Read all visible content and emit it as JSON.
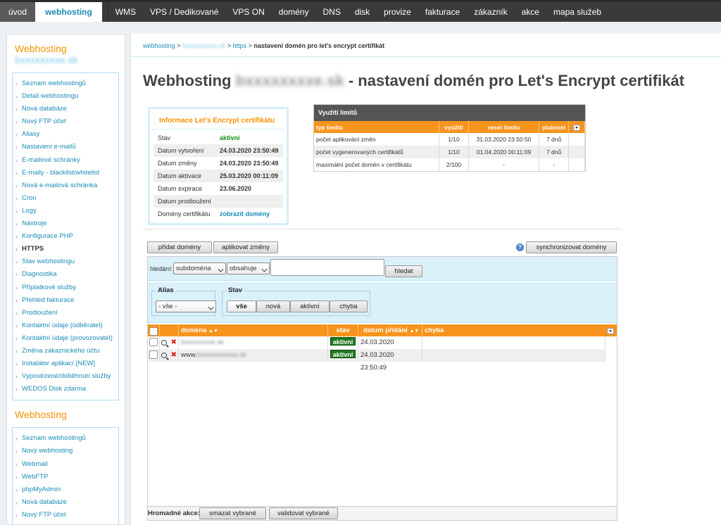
{
  "topnav": {
    "items": [
      "úvod",
      "webhosting",
      "WMS",
      "VPS / Dedikované",
      "VPS ON",
      "domény",
      "DNS",
      "disk",
      "provize",
      "fakturace",
      "zákazník",
      "akce",
      "mapa služeb"
    ]
  },
  "sidebar": {
    "block1_title": "Webhosting",
    "block1_domain": "bxxxxxxxxe.sk",
    "block1_items": [
      "Seznam webhostingů",
      "Detail webhostingu",
      "Nová databáze",
      "Nový FTP účet",
      "Aliasy",
      "Nastavení e-mailů",
      "E-mailové schránky",
      "E-maily - blacklist/whitelist",
      "Nová e-mailová schránka",
      "Cron",
      "Logy",
      "Nástroje",
      "Konfigurace PHP",
      "HTTPS",
      "Stav webhostingu",
      "Diagnostika",
      "Příplatkové služby",
      "Přehled fakturace",
      "Prodloužení",
      "Kontaktní údaje (odběratel)",
      "Kontaktní údaje (provozovatel)",
      "Změna zákaznického účtu",
      "Instalátor aplikací [NEW]",
      "Vypovězené/doběhnutí služby",
      "WEDOS Disk zdarma"
    ],
    "block2_title": "Webhosting",
    "block2_items": [
      "Seznam webhostingů",
      "Nový webhosting",
      "Webmail",
      "WebFTP",
      "phpMyAdmin",
      "Nová databáze",
      "Nový FTP účet"
    ]
  },
  "breadcrumb": {
    "webhosting": "webhosting",
    "sep": ">",
    "domain": "bxxxxxxxxxx.sk",
    "https": "https",
    "current": "nastavení domén pro let's encrypt certifikát"
  },
  "title": {
    "prefix": "Webhosting",
    "domain": "bxxxxxxxxe.sk",
    "suffix": "- nastavení domén pro Let's Encrypt certifikát"
  },
  "info": {
    "title": "Informace Let's Encrypt certifikátu",
    "rows": [
      {
        "k": "Stav",
        "v": "aktivní"
      },
      {
        "k": "Datum vytvoření",
        "v": "24.03.2020 23:50:49"
      },
      {
        "k": "Datum změny",
        "v": "24.03.2020 23:50:49"
      },
      {
        "k": "Datum aktivace",
        "v": "25.03.2020 00:11:09"
      },
      {
        "k": "Datum expirace",
        "v": "23.06.2020"
      },
      {
        "k": "Datum prodloužení",
        "v": ""
      },
      {
        "k": "Domény certifikátu",
        "v": "zobrazit domény"
      }
    ]
  },
  "limits": {
    "title": "Využití limitů",
    "headers": [
      "typ limitu",
      "využití",
      "reset limitu",
      "platnost"
    ],
    "rows": [
      [
        "počet aplikování změn",
        "1/10",
        "31.03.2020 23:50:50",
        "7 dnů"
      ],
      [
        "počet vygenerovaných certifikátů",
        "1/10",
        "01.04.2020 00:11:09",
        "7 dnů"
      ],
      [
        "maximální počet domén v certifikátu",
        "2/100",
        "-",
        "-"
      ]
    ]
  },
  "actions": {
    "add": "přidat domény",
    "apply": "aplikovat změny",
    "sync": "synchronizovat domény",
    "help": "?"
  },
  "search": {
    "label": "hledání:",
    "field": "subdoména",
    "op": "obsahuje",
    "value": "",
    "button": "hledat"
  },
  "filters": {
    "alias_label": "Alias",
    "alias_value": "- vše -",
    "state_label": "Stav",
    "state_buttons": [
      "vše",
      "nová",
      "aktivní",
      "chyba"
    ]
  },
  "results": {
    "headers": {
      "domain": "doména",
      "state": "stav",
      "date": "datum přidání",
      "error": "chyba"
    },
    "rows": [
      {
        "domain_prefix": "",
        "domain": "bxxxxxxxxe.sk",
        "state": "aktivní",
        "date": "24.03.2020 23:50:49",
        "error": ""
      },
      {
        "domain_prefix": "www.",
        "domain": "bxxxxxxxxxxe.sk",
        "state": "aktivní",
        "date": "24.03.2020 23:50:49",
        "error": ""
      }
    ]
  },
  "bulk": {
    "label": "Hromadné akce:",
    "delete": "smazat vybrané",
    "validate": "validovat vybrané"
  },
  "colors": {
    "accent": "#f39200",
    "link": "#1a8bb5",
    "ok": "#1e7b1e",
    "nav": "#3a3a3a"
  }
}
